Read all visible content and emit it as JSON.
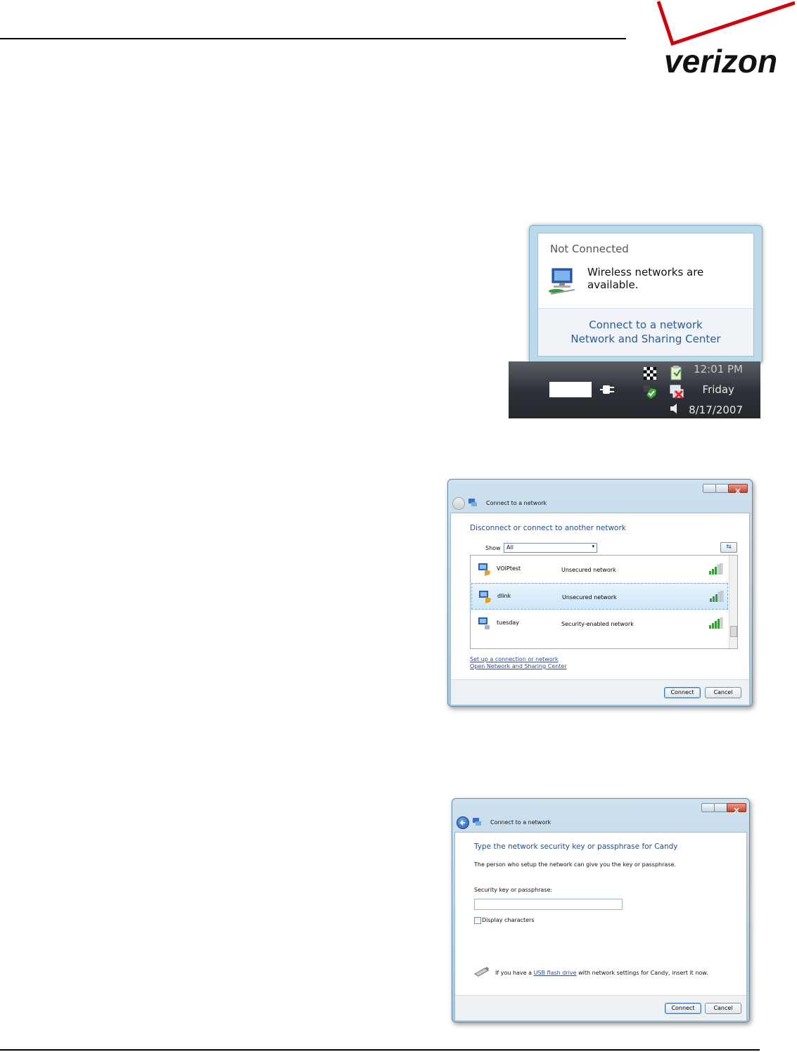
{
  "logo": {
    "text": "verizon",
    "brand_color": "#cd040b",
    "text_color": "#000000"
  },
  "balloon": {
    "title": "Not Connected",
    "message": "Wireless networks are available.",
    "links": [
      "Connect to a network",
      "Network and Sharing Center"
    ],
    "icon": "network-computer-icon"
  },
  "taskbar": {
    "time": "12:01 PM",
    "day": "Friday",
    "date": "8/17/2007"
  },
  "dialog1": {
    "title": "Connect to a network",
    "heading": "Disconnect or connect to another network",
    "show_label": "Show",
    "show_value": "All",
    "networks": [
      {
        "name": "VOIPtest",
        "status": "Unsecured network",
        "selected": false
      },
      {
        "name": "dlink",
        "status": "Unsecured network",
        "selected": true
      },
      {
        "name": "tuesday",
        "status": "Security-enabled network",
        "selected": false
      }
    ],
    "links": [
      "Set up a connection or network",
      "Open Network and Sharing Center"
    ],
    "connect": "Connect",
    "cancel": "Cancel"
  },
  "dialog2": {
    "title": "Connect to a network",
    "heading": "Type the network security key or passphrase for Candy",
    "subtext": "The person who setup the network can give you the key or passphrase.",
    "field_label": "Security key or passphrase:",
    "field_value": "",
    "checkbox_label": "Display characters",
    "usb_pre": "If you have a",
    "usb_link": "USB flash drive",
    "usb_post": "with network settings for Candy, insert it now.",
    "connect": "Connect",
    "cancel": "Cancel"
  }
}
